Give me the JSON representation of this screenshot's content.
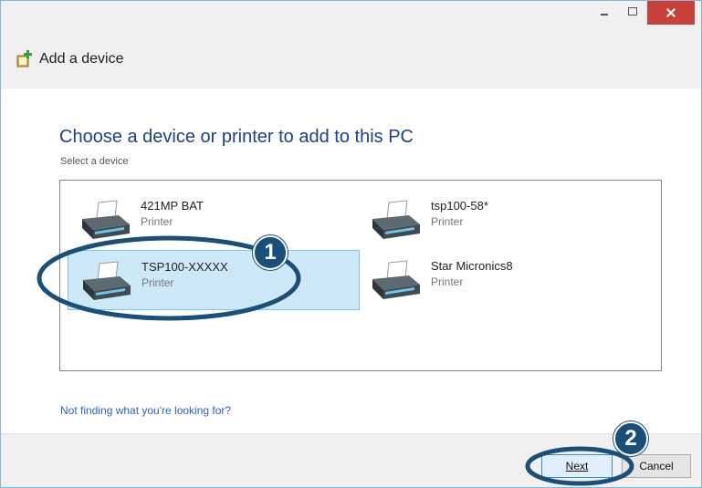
{
  "window": {
    "title": "Add a device",
    "controls": {
      "minimize": "minimize",
      "maximize": "maximize",
      "close": "close"
    }
  },
  "main": {
    "heading": "Choose a device or printer to add to this PC",
    "subheading": "Select a device",
    "devices": [
      {
        "name": "421MP BAT",
        "type": "Printer",
        "selected": false
      },
      {
        "name": "tsp100-58*",
        "type": "Printer",
        "selected": false
      },
      {
        "name": "TSP100-XXXXX",
        "type": "Printer",
        "selected": true
      },
      {
        "name": "Star Micronics8",
        "type": "Printer",
        "selected": false
      }
    ],
    "help_link": "Not finding what you're looking for?"
  },
  "footer": {
    "next_label": "Next",
    "cancel_label": "Cancel"
  },
  "annotations": {
    "step1": "1",
    "step2": "2",
    "color": "#1a4f7a"
  },
  "icons": {
    "app": "add-device-icon",
    "printer": "printer-icon"
  },
  "colors": {
    "heading": "#1f3f8a",
    "link": "#2a63b5",
    "selection": "#cde8f7",
    "close_button": "#c7403a"
  }
}
